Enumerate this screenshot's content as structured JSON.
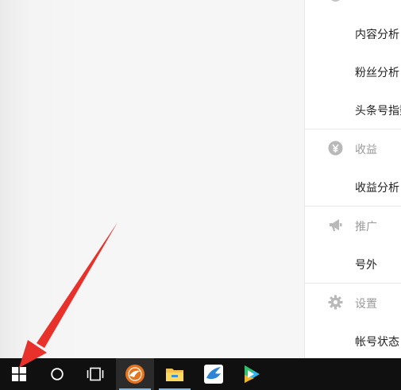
{
  "sidebar": {
    "sections": [
      {
        "label": "收益",
        "icon": "yen-circle-icon"
      },
      {
        "label": "推广",
        "icon": "megaphone-icon"
      },
      {
        "label": "设置",
        "icon": "gear-icon"
      }
    ],
    "items": [
      {
        "label": "内容分析"
      },
      {
        "label": "粉丝分析"
      },
      {
        "label": "头条号指数"
      },
      {
        "label": "收益分析"
      },
      {
        "label": "号外"
      },
      {
        "label": "帐号状态"
      }
    ]
  },
  "taskbar": {
    "buttons": [
      {
        "icon": "windows-start-icon"
      },
      {
        "icon": "cortana-search-icon"
      },
      {
        "icon": "task-view-icon"
      },
      {
        "icon": "orange-browser-icon"
      },
      {
        "icon": "file-explorer-icon"
      },
      {
        "icon": "blue-bird-app-icon"
      },
      {
        "icon": "video-player-icon"
      }
    ]
  },
  "annotation": {
    "arrow_color": "#e8312a"
  }
}
